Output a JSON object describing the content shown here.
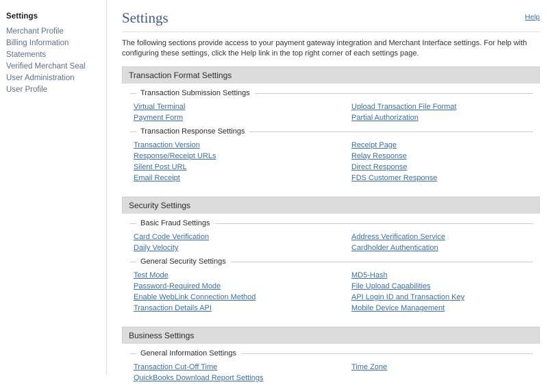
{
  "sidebar": {
    "title": "Settings",
    "items": [
      {
        "label": "Merchant Profile"
      },
      {
        "label": "Billing Information"
      },
      {
        "label": "Statements"
      },
      {
        "label": "Verified Merchant Seal"
      },
      {
        "label": "User Administration"
      },
      {
        "label": "User Profile"
      }
    ]
  },
  "header": {
    "title": "Settings",
    "help_label": "Help"
  },
  "intro": "The following sections provide access to your payment gateway integration and Merchant Interface settings. For help with configuring these settings, click the Help link in the top right corner of each settings page.",
  "sections": [
    {
      "title": "Transaction Format Settings",
      "groups": [
        {
          "legend": "Transaction Submission Settings",
          "rows": [
            {
              "left": "Virtual Terminal",
              "right": "Upload Transaction File Format"
            },
            {
              "left": "Payment Form",
              "right": "Partial Authorization"
            }
          ]
        },
        {
          "legend": "Transaction Response Settings",
          "rows": [
            {
              "left": "Transaction Version",
              "right": "Receipt Page"
            },
            {
              "left": "Response/Receipt URLs",
              "right": "Relay Response"
            },
            {
              "left": "Silent Post URL",
              "right": "Direct Response"
            },
            {
              "left": "Email Receipt",
              "right": "FDS Customer Response"
            }
          ]
        }
      ]
    },
    {
      "title": "Security Settings",
      "groups": [
        {
          "legend": "Basic Fraud Settings",
          "rows": [
            {
              "left": "Card Code Verification",
              "right": "Address Verification Service"
            },
            {
              "left": "Daily Velocity",
              "right": "Cardholder Authentication"
            }
          ]
        },
        {
          "legend": "General Security Settings",
          "rows": [
            {
              "left": "Test Mode",
              "right": "MD5-Hash"
            },
            {
              "left": "Password-Required Mode",
              "right": "File Upload Capabilities"
            },
            {
              "left": "Enable WebLink Connection Method",
              "right": "API Login ID and Transaction Key"
            },
            {
              "left": "Transaction Details API",
              "right": "Mobile Device Management"
            }
          ]
        }
      ]
    },
    {
      "title": "Business Settings",
      "groups": [
        {
          "legend": "General Information Settings",
          "rows": [
            {
              "left": "Transaction Cut-Off Time",
              "right": "Time Zone"
            },
            {
              "left": "QuickBooks Download Report Settings",
              "right": ""
            }
          ]
        }
      ]
    }
  ],
  "colors": {
    "link": "#3a6ea5",
    "sidebar_link": "#5d6f8c",
    "title": "#3f5a86",
    "section_header_bg": "#dcdcdc"
  }
}
